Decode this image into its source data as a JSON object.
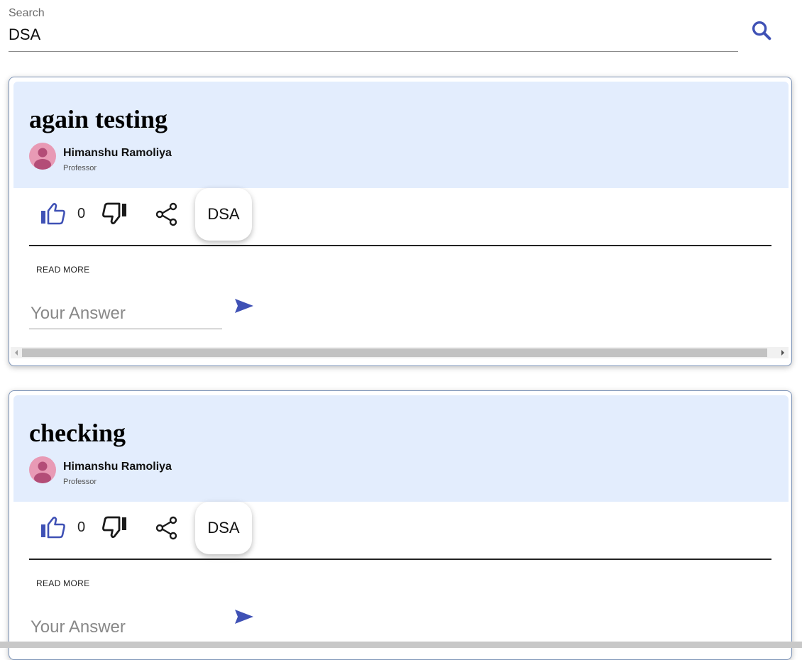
{
  "search": {
    "label": "Search",
    "value": "DSA"
  },
  "colors": {
    "accent": "#3f51b5",
    "card_header": "#e3edfd",
    "avatar": "#e89ab5"
  },
  "icons": {
    "search": "search-icon",
    "like": "thumb-up-icon",
    "dislike": "thumb-down-icon",
    "share": "share-icon",
    "send": "send-icon",
    "avatar": "person-icon"
  },
  "questions": [
    {
      "title": "again testing",
      "author": "Himanshu Ramoliya",
      "role": "Professor",
      "likes": "0",
      "tag": "DSA",
      "read_more": "READ MORE",
      "answer_placeholder": "Your Answer"
    },
    {
      "title": "checking",
      "author": "Himanshu Ramoliya",
      "role": "Professor",
      "likes": "0",
      "tag": "DSA",
      "read_more": "READ MORE",
      "answer_placeholder": "Your Answer"
    }
  ]
}
